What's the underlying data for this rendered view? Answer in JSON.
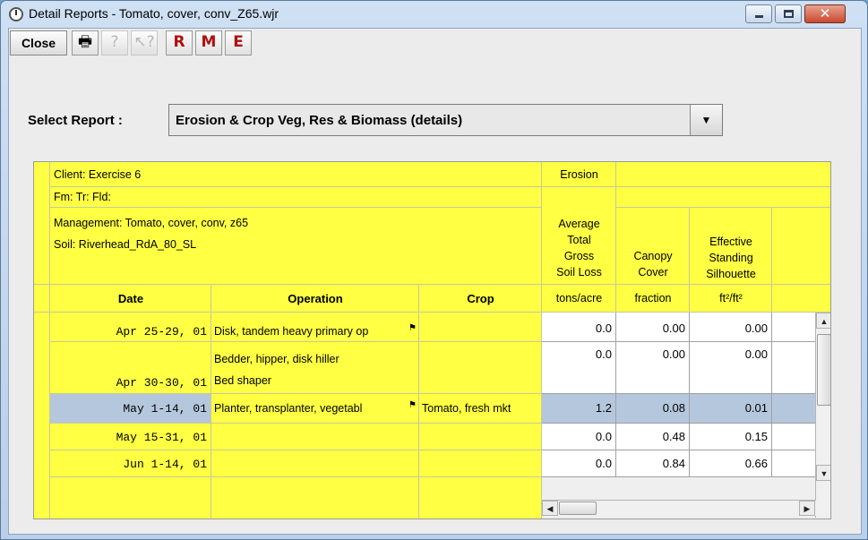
{
  "window": {
    "title": "Detail Reports - Tomato, cover, conv_Z65.wjr",
    "close_glyph": "✕"
  },
  "toolbar": {
    "close_label": "Close",
    "icons": [
      "printer-icon",
      "help-icon",
      "context-help-icon",
      "report-r-icon",
      "report-m-icon",
      "report-e-icon"
    ]
  },
  "select": {
    "label": "Select Report :",
    "value": "Erosion & Crop Veg, Res & Biomass (details)"
  },
  "report": {
    "header_info": [
      "Client: Exercise 6",
      "Fm:  Tr:  Fld:",
      "Management: Tomato, cover, conv, z65",
      "Soil: Riverhead_RdA_80_SL"
    ],
    "group_header": "Erosion",
    "col_headers": {
      "date": "Date",
      "operation": "Operation",
      "crop": "Crop",
      "soil_loss": [
        "Average",
        "Total",
        "Gross",
        "Soil Loss"
      ],
      "canopy": [
        "Canopy",
        "Cover"
      ],
      "silhouette": [
        "Effective",
        "Standing",
        "Silhouette"
      ]
    },
    "units": {
      "soil_loss": "tons/acre",
      "canopy": "fraction",
      "silhouette": "ft²/ft²"
    },
    "rows": [
      {
        "date": "Apr 25-29, 01",
        "operation": "Disk, tandem heavy primary op",
        "operation2": "",
        "crop": "",
        "soil_loss": "0.0",
        "canopy": "0.00",
        "silhouette": "0.00"
      },
      {
        "date": "Apr 30-30, 01",
        "operation": "Bedder, hipper, disk hiller",
        "operation2": "Bed shaper",
        "crop": "",
        "soil_loss": "0.0",
        "canopy": "0.00",
        "silhouette": "0.00"
      },
      {
        "date": "May  1-14, 01",
        "operation": "Planter, transplanter, vegetabl",
        "operation2": "",
        "crop": "Tomato, fresh mkt",
        "soil_loss": "1.2",
        "canopy": "0.08",
        "silhouette": "0.01"
      },
      {
        "date": "May 15-31, 01",
        "operation": "",
        "operation2": "",
        "crop": "",
        "soil_loss": "0.0",
        "canopy": "0.48",
        "silhouette": "0.15"
      },
      {
        "date": "Jun  1-14, 01",
        "operation": "",
        "operation2": "",
        "crop": "",
        "soil_loss": "0.0",
        "canopy": "0.84",
        "silhouette": "0.66"
      }
    ]
  },
  "colors": {
    "yellow": "#ffff44",
    "selected": "#b5c7dc"
  }
}
